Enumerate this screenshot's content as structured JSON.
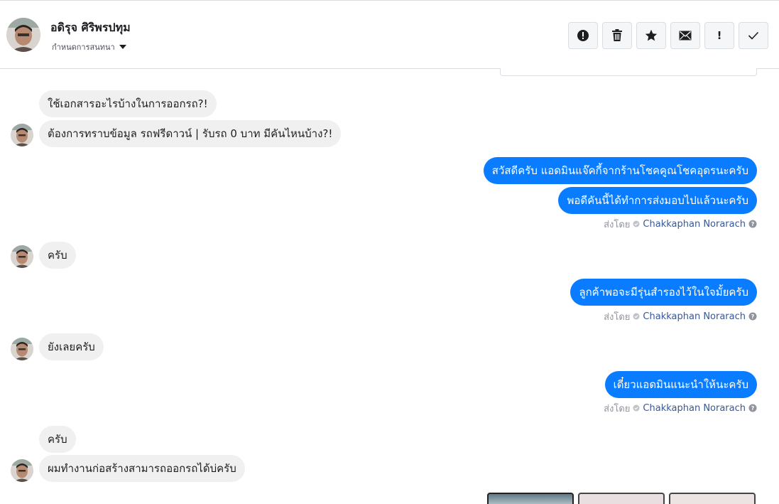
{
  "header": {
    "contact_name": "อดิรุจ ศิริพรปทุม",
    "manage_label": "กำหนดการสนทนา",
    "avatar_icon": "user-avatar",
    "actions": [
      {
        "name": "spam-button",
        "icon": "alert-circle-icon"
      },
      {
        "name": "delete-button",
        "icon": "trash-icon"
      },
      {
        "name": "star-button",
        "icon": "star-icon"
      },
      {
        "name": "mark-unread-button",
        "icon": "envelope-icon"
      },
      {
        "name": "follow-up-button",
        "label": "!"
      },
      {
        "name": "done-button",
        "icon": "checkmark-icon"
      }
    ]
  },
  "messages": {
    "m1": "ใช้เอกสารอะไรบ้างในการออกรถ?!",
    "m2": "ต้องการทราบข้อมูล รถฟรีดาวน์ | รับรถ 0 บาท มีคันไหนบ้าง?!",
    "m3": "สวัสดีครับ แอดมินแจ๊คกี้จากร้านโชคคูณโชคอุดรนะครับ",
    "m4": "พอดีคันนี้ได้ทำการส่งมอบไปแล้วนะครับ",
    "m5": "ครับ",
    "m6": "ลูกค้าพอจะมีรุ่นสำรองไว้ในใจมั้ยครับ",
    "m7": "ยังเลยครับ",
    "m8": "เดี๋ยวแอดมินแนะนำให้นะครับ",
    "m9": "ครับ",
    "m10": "ผมทำงานก่อสร้างสามารถออกรถได้บ่ครับ"
  },
  "sent_by": {
    "prefix": "ส่งโดย",
    "agent": "Chakkaphan Norarach"
  },
  "colors": {
    "outgoing_bubble": "#0a7cff",
    "incoming_bubble": "#f1f0f0",
    "agent_link": "#385898"
  }
}
